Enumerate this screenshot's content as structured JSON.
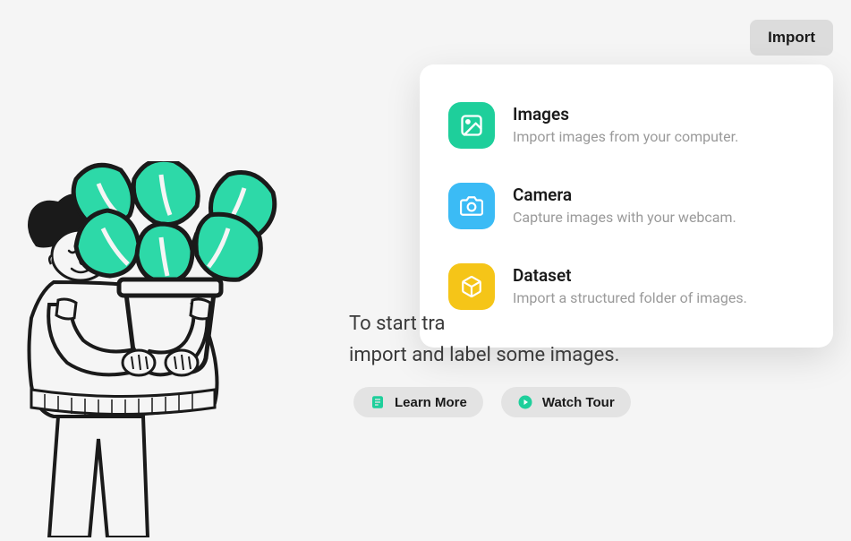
{
  "toolbar": {
    "import_label": "Import"
  },
  "dropdown": {
    "items": [
      {
        "title": "Images",
        "desc": "Import images from your computer.",
        "icon": "image-icon",
        "color": "green"
      },
      {
        "title": "Camera",
        "desc": "Capture images with your webcam.",
        "icon": "camera-icon",
        "color": "blue"
      },
      {
        "title": "Dataset",
        "desc": "Import a structured folder of images.",
        "icon": "cube-icon",
        "color": "yellow"
      }
    ]
  },
  "main": {
    "line1": "To start tra",
    "line2": "import and label some images."
  },
  "actions": {
    "learn_more_label": "Learn More",
    "watch_tour_label": "Watch Tour"
  }
}
